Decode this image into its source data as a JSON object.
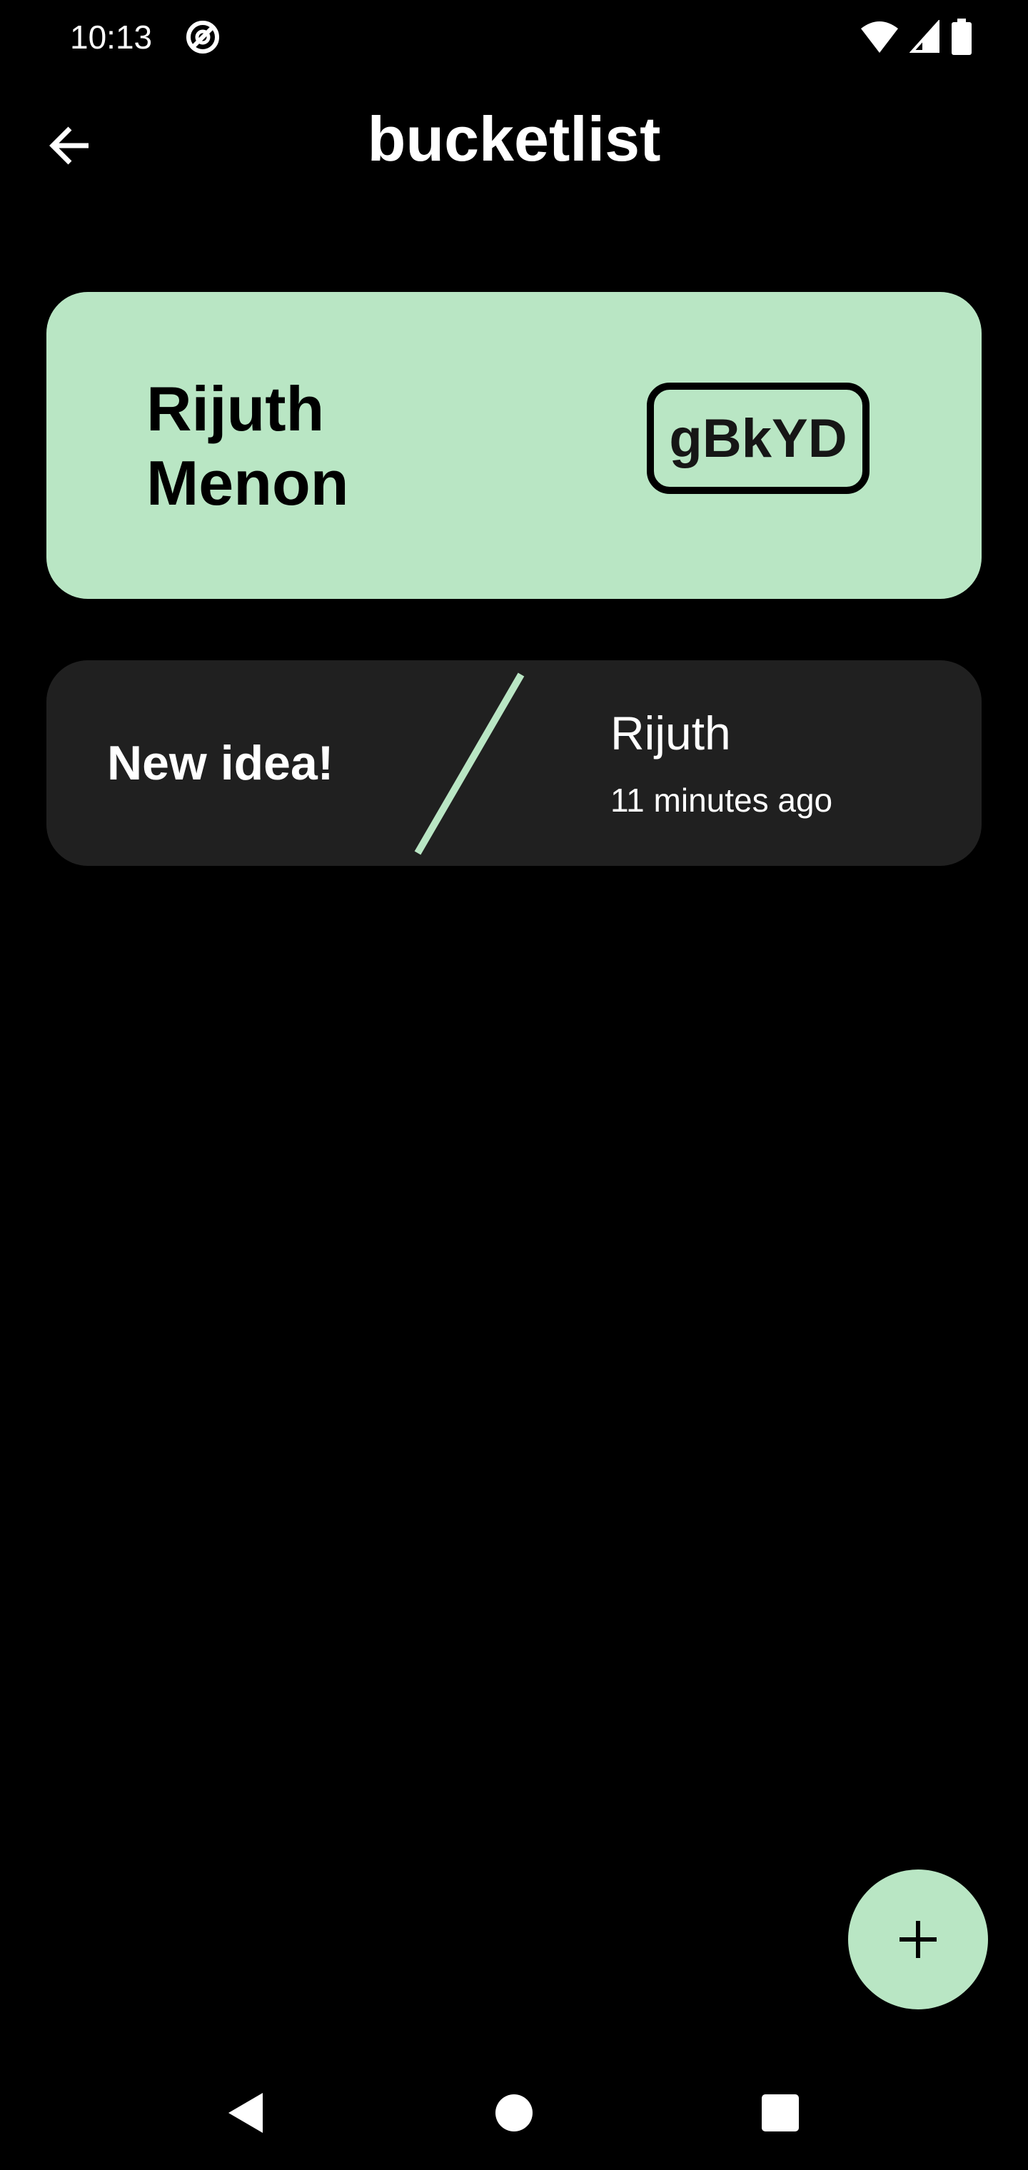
{
  "status_bar": {
    "time": "10:13",
    "icons": [
      "data-saver-icon",
      "wifi-icon",
      "cellular-signal-icon",
      "battery-icon"
    ]
  },
  "app_bar": {
    "title": "bucketlist",
    "back_icon": "arrow-back-icon"
  },
  "profile_card": {
    "name": "Rijuth Menon",
    "room_code": "gBkYD"
  },
  "ideas": [
    {
      "title": "New idea!",
      "author": "Rijuth",
      "time": "11 minutes ago"
    }
  ],
  "fab": {
    "icon": "plus-icon"
  },
  "nav_bar": {
    "icons": [
      "nav-back-icon",
      "nav-home-icon",
      "nav-recents-icon"
    ]
  },
  "colors": {
    "background": "#000000",
    "accent": "#b9e6c4",
    "card": "#202020",
    "text": "#ffffff"
  }
}
